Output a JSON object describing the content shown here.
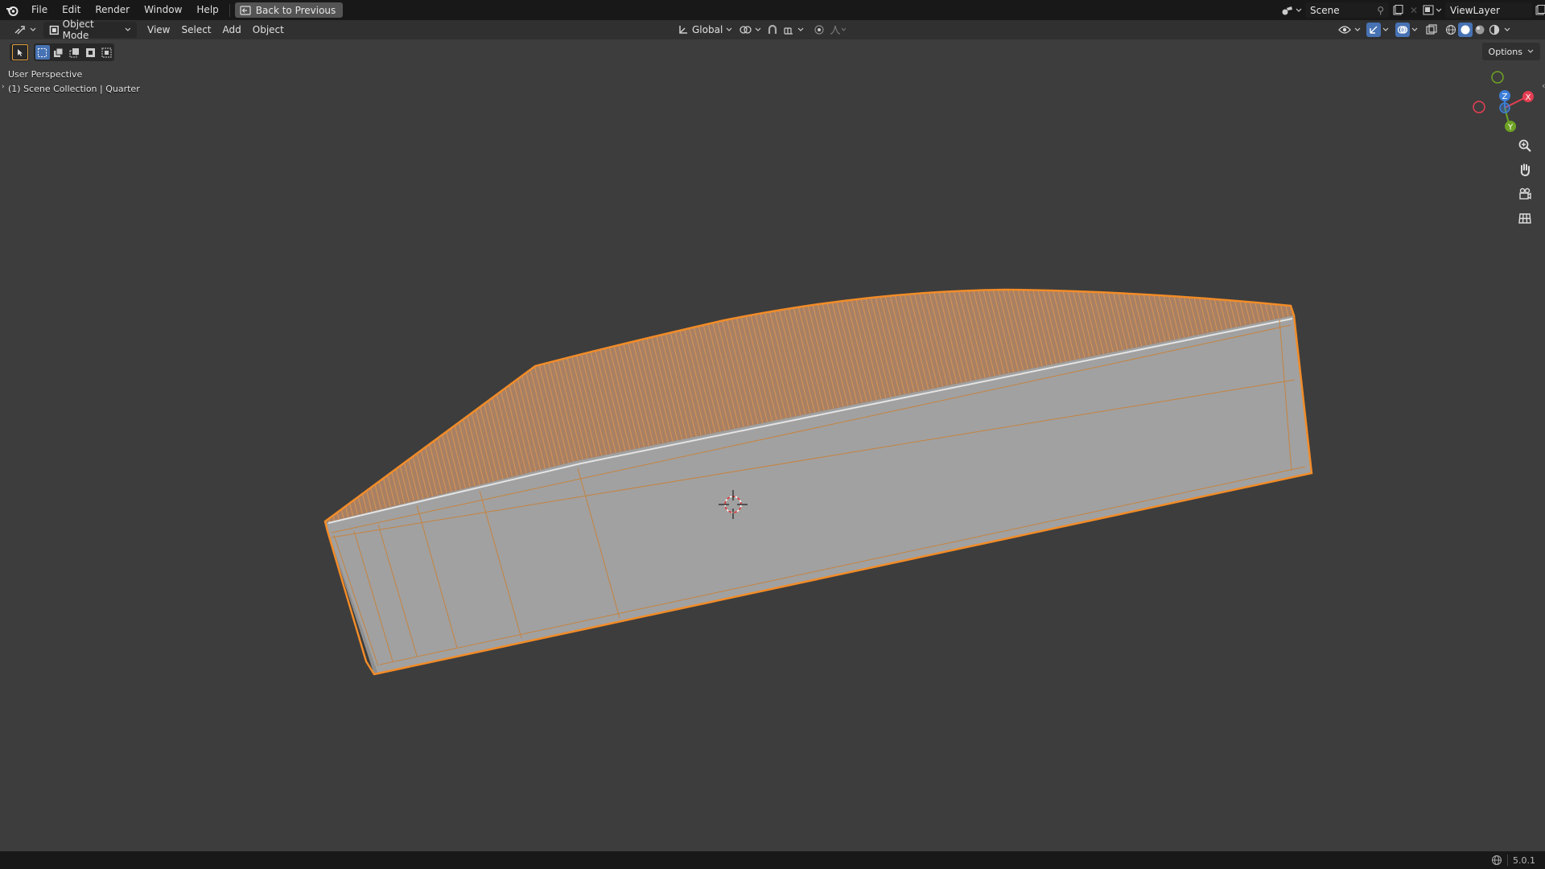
{
  "menubar": {
    "items": [
      "File",
      "Edit",
      "Render",
      "Window",
      "Help"
    ],
    "back_button": "Back to Previous",
    "scene": "Scene",
    "view_layer": "ViewLayer"
  },
  "header": {
    "mode": "Object Mode",
    "menus": [
      "View",
      "Select",
      "Add",
      "Object"
    ],
    "orientation": "Global",
    "options": "Options"
  },
  "viewport": {
    "perspective": "User Perspective",
    "collection": "(1) Scene Collection | Quarter",
    "gizmo_axes": [
      "X",
      "Y",
      "Z"
    ]
  },
  "status": {
    "version": "5.0.1"
  },
  "colors": {
    "selection_outline": "#f28c28",
    "active_blue": "#4772b3",
    "axis_x": "#e53e52",
    "axis_y": "#6ea224",
    "axis_z": "#3d7fd9"
  },
  "icons": [
    "blender-logo-icon",
    "back-icon",
    "editor-type-icon",
    "object-mode-icon",
    "transform-orientation-icon",
    "pivot-icon",
    "snap-icon",
    "proportional-icon",
    "visibility-icon",
    "gizmo-icon",
    "overlay-icon",
    "xray-icon",
    "shading-wireframe-icon",
    "shading-solid-icon",
    "shading-material-icon",
    "shading-rendered-icon",
    "zoom-icon",
    "pan-hand-icon",
    "camera-icon",
    "grid-icon",
    "network-icon"
  ]
}
